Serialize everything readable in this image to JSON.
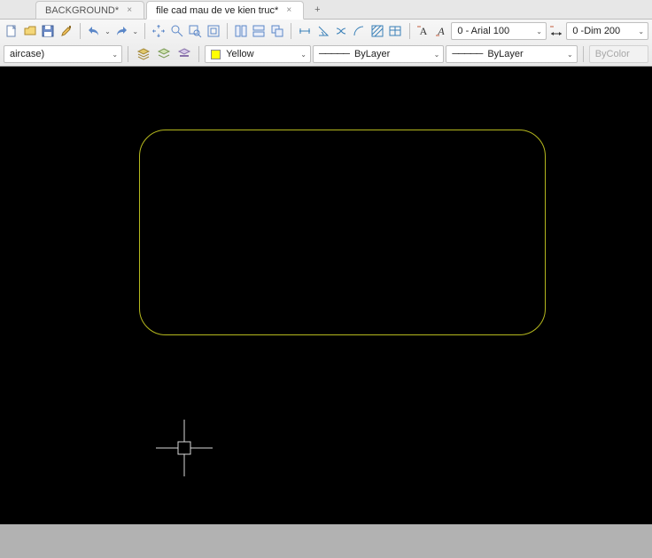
{
  "tabs": [
    {
      "label": "BACKGROUND*",
      "active": false
    },
    {
      "label": "file cad mau de ve kien truc*",
      "active": true
    }
  ],
  "combos": {
    "textStyle": "0 - Arial 100",
    "dimStyle": "0 -Dim 200",
    "layer": "aircase)",
    "colorName": "Yellow",
    "linetype": "ByLayer",
    "lineweight": "ByLayer",
    "plotStyle": "ByColor"
  },
  "colors": {
    "swatch": "#ffff00"
  },
  "icons": {
    "close": "×",
    "plus": "+",
    "chevron": "⌄",
    "line": "─────"
  }
}
